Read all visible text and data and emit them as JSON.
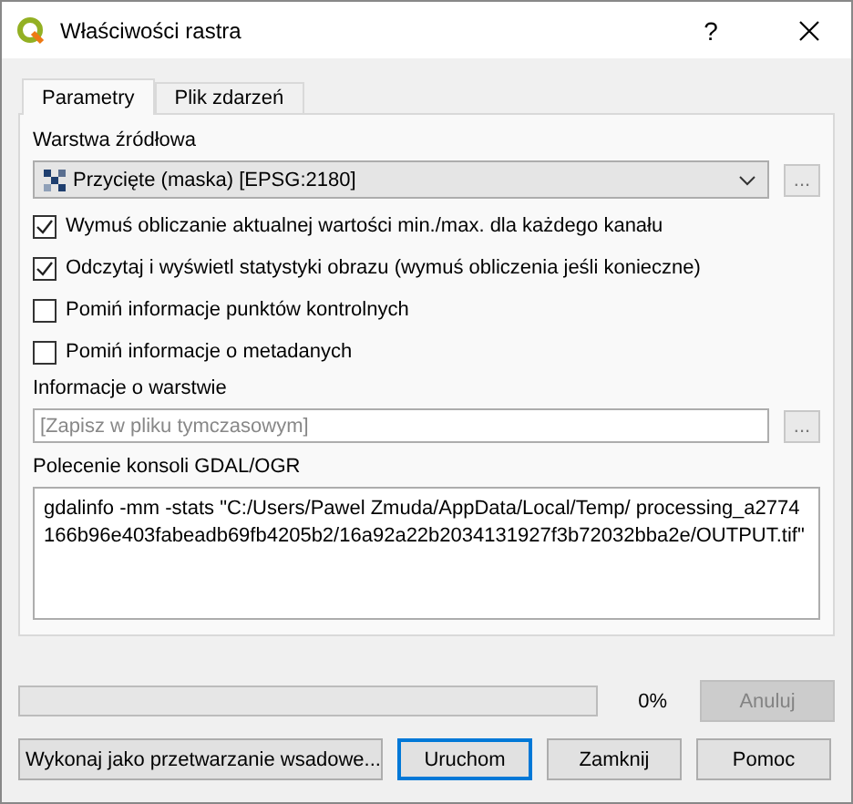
{
  "window": {
    "title": "Właściwości rastra",
    "help": "?"
  },
  "tabs": [
    {
      "label": "Parametry",
      "selected": true
    },
    {
      "label": "Plik zdarzeń",
      "selected": false
    }
  ],
  "source_layer": {
    "label": "Warstwa źródłowa",
    "value": "Przycięte (maska) [EPSG:2180]",
    "browse": "..."
  },
  "options": [
    {
      "label": "Wymuś obliczanie aktualnej wartości min./max. dla każdego kanału",
      "checked": true
    },
    {
      "label": "Odczytaj i wyświetl statystyki obrazu (wymuś obliczenia jeśli konieczne)",
      "checked": true
    },
    {
      "label": "Pomiń informacje punktów kontrolnych",
      "checked": false
    },
    {
      "label": "Pomiń informacje o metadanych",
      "checked": false
    }
  ],
  "layer_info": {
    "label": "Informacje o warstwie",
    "placeholder": "[Zapisz w pliku tymczasowym]",
    "browse": "..."
  },
  "console": {
    "label": "Polecenie konsoli GDAL/OGR",
    "value": "gdalinfo -mm -stats \"C:/Users/Pawel Zmuda/AppData/Local/Temp/ processing_a2774166b96e403fabeadb69fb4205b2/16a92a22b2034131927f3b72032bba2e/OUTPUT.tif\""
  },
  "progress": {
    "level": 0,
    "reading": "0%"
  },
  "cancel": {
    "label": "Anuluj",
    "disabled": true
  },
  "buttons": [
    {
      "label": "Wykonaj jako przetwarzanie wsadowe...",
      "focused": false
    },
    {
      "label": "Uruchom",
      "focused": true
    },
    {
      "label": "Zamknij",
      "focused": false
    },
    {
      "label": "Pomoc",
      "focused": false
    }
  ]
}
